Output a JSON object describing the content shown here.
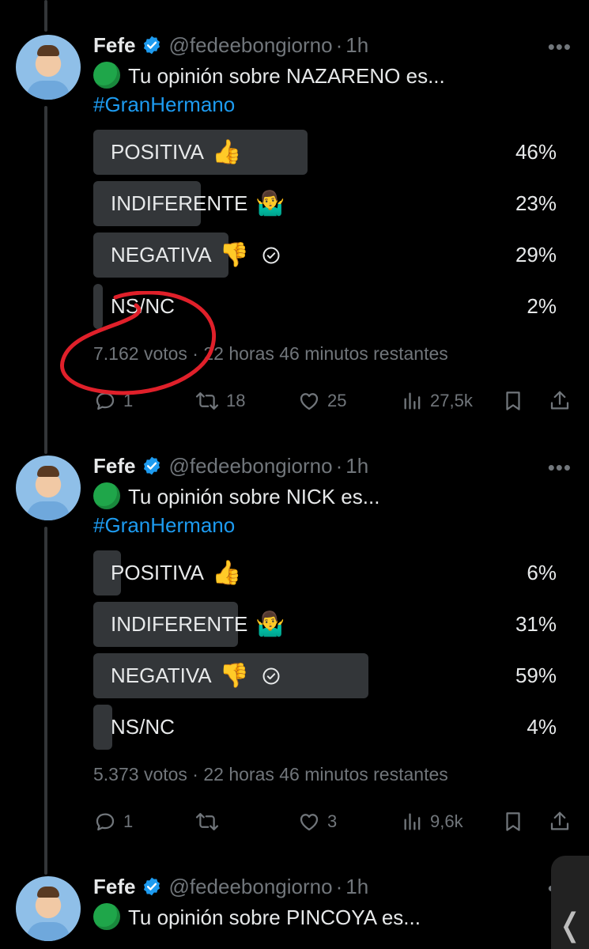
{
  "tweets": [
    {
      "author": {
        "name": "Fefe",
        "handle": "@fedeebongiorno",
        "time": "1h"
      },
      "emoji_prefix": "green-circle",
      "text": "Tu opinión sobre NAZARENO es...",
      "hashtag": "#GranHermano",
      "poll": {
        "options": [
          {
            "label": "POSITIVA",
            "emoji": "👍",
            "percent": "46%",
            "share": 0.46,
            "selected": false
          },
          {
            "label": "INDIFERENTE",
            "emoji": "🤷‍♂️",
            "percent": "23%",
            "share": 0.23,
            "selected": false
          },
          {
            "label": "NEGATIVA",
            "emoji": "👎",
            "percent": "29%",
            "share": 0.29,
            "selected": true
          },
          {
            "label": "NS/NC",
            "emoji": "",
            "percent": "2%",
            "share": 0.02,
            "selected": false
          }
        ],
        "meta": "7.162 votos · 22 horas 46 minutos restantes"
      },
      "actions": {
        "replies": "1",
        "reposts": "18",
        "likes": "25",
        "views": "27,5k"
      }
    },
    {
      "author": {
        "name": "Fefe",
        "handle": "@fedeebongiorno",
        "time": "1h"
      },
      "emoji_prefix": "green-circle",
      "text": "Tu opinión sobre NICK es...",
      "hashtag": "#GranHermano",
      "poll": {
        "options": [
          {
            "label": "POSITIVA",
            "emoji": "👍",
            "percent": "6%",
            "share": 0.06,
            "selected": false
          },
          {
            "label": "INDIFERENTE",
            "emoji": "🤷‍♂️",
            "percent": "31%",
            "share": 0.31,
            "selected": false
          },
          {
            "label": "NEGATIVA",
            "emoji": "👎",
            "percent": "59%",
            "share": 0.59,
            "selected": true
          },
          {
            "label": "NS/NC",
            "emoji": "",
            "percent": "4%",
            "share": 0.04,
            "selected": false
          }
        ],
        "meta": "5.373 votos · 22 horas 46 minutos restantes"
      },
      "actions": {
        "replies": "1",
        "reposts": "",
        "likes": "3",
        "views": "9,6k"
      }
    },
    {
      "author": {
        "name": "Fefe",
        "handle": "@fedeebongiorno",
        "time": "1h"
      },
      "emoji_prefix": "green-circle",
      "text": "Tu opinión sobre PINCOYA es..."
    }
  ],
  "colors": {
    "background": "#000000",
    "text": "#e7e9ea",
    "muted": "#71767b",
    "link": "#1d9bf0",
    "bar": "#333639",
    "verified": "#1d9bf0",
    "annotation": "#e0202a"
  },
  "icons": {
    "verified": "verified-badge-icon",
    "more": "more-dots-icon",
    "reply": "reply-icon",
    "repost": "repost-icon",
    "like": "heart-icon",
    "views": "views-chart-icon",
    "bookmark": "bookmark-icon",
    "share": "share-icon",
    "check": "check-circle-icon",
    "scroll": "chevron-left-icon"
  }
}
